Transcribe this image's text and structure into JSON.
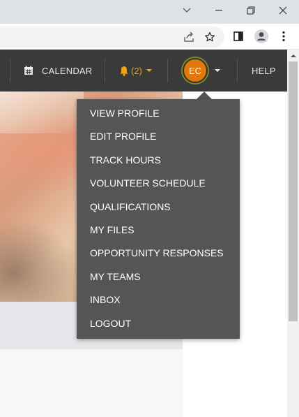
{
  "browser": {
    "window_controls": {
      "tab_search_icon": "chevron-down-icon",
      "minimize_icon": "minimize-icon",
      "restore_icon": "restore-icon",
      "close_icon": "close-icon"
    },
    "toolbar_icons": [
      "share-icon",
      "star-icon",
      "side-panel-icon",
      "profile-icon",
      "more-vert-icon"
    ]
  },
  "nav": {
    "calendar_label": "CALENDAR",
    "notifications_label": "(2)",
    "avatar_initials": "EC",
    "help_label": "HELP"
  },
  "menu": {
    "items": [
      "VIEW PROFILE",
      "EDIT PROFILE",
      "TRACK HOURS",
      "VOLUNTEER SCHEDULE",
      "QUALIFICATIONS",
      "MY FILES",
      "OPPORTUNITY RESPONSES",
      "MY TEAMS",
      "INBOX",
      "LOGOUT"
    ]
  },
  "colors": {
    "nav_bg": "#3a3a3a",
    "menu_bg": "#555555",
    "accent_orange": "#e2780c",
    "notification_color": "#f0a30a",
    "avatar_ring": "#7a8a2e"
  }
}
